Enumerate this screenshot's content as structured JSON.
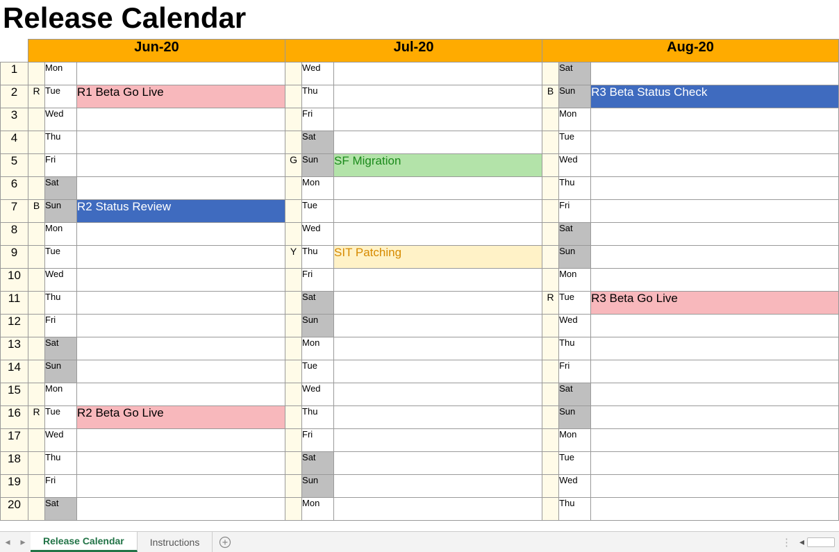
{
  "title": "Release Calendar",
  "months": [
    "Jun-20",
    "Jul-20",
    "Aug-20"
  ],
  "row_numbers": [
    1,
    2,
    3,
    4,
    5,
    6,
    7,
    8,
    9,
    10,
    11,
    12,
    13,
    14,
    15,
    16,
    17,
    18,
    19,
    20
  ],
  "rows": [
    {
      "m1": {
        "code": "",
        "day": "Mon",
        "weekend": false,
        "event": "",
        "color": ""
      },
      "m2": {
        "code": "",
        "day": "Wed",
        "weekend": false,
        "event": "",
        "color": ""
      },
      "m3": {
        "code": "",
        "day": "Sat",
        "weekend": true,
        "event": "",
        "color": ""
      }
    },
    {
      "m1": {
        "code": "R",
        "day": "Tue",
        "weekend": false,
        "event": "R1 Beta Go Live",
        "color": "red"
      },
      "m2": {
        "code": "",
        "day": "Thu",
        "weekend": false,
        "event": "",
        "color": ""
      },
      "m3": {
        "code": "B",
        "day": "Sun",
        "weekend": true,
        "event": "R3 Beta Status Check",
        "color": "blue"
      }
    },
    {
      "m1": {
        "code": "",
        "day": "Wed",
        "weekend": false,
        "event": "",
        "color": ""
      },
      "m2": {
        "code": "",
        "day": "Fri",
        "weekend": false,
        "event": "",
        "color": ""
      },
      "m3": {
        "code": "",
        "day": "Mon",
        "weekend": false,
        "event": "",
        "color": ""
      }
    },
    {
      "m1": {
        "code": "",
        "day": "Thu",
        "weekend": false,
        "event": "",
        "color": ""
      },
      "m2": {
        "code": "",
        "day": "Sat",
        "weekend": true,
        "event": "",
        "color": ""
      },
      "m3": {
        "code": "",
        "day": "Tue",
        "weekend": false,
        "event": "",
        "color": ""
      }
    },
    {
      "m1": {
        "code": "",
        "day": "Fri",
        "weekend": false,
        "event": "",
        "color": ""
      },
      "m2": {
        "code": "G",
        "day": "Sun",
        "weekend": true,
        "event": "SF Migration",
        "color": "green"
      },
      "m3": {
        "code": "",
        "day": "Wed",
        "weekend": false,
        "event": "",
        "color": ""
      }
    },
    {
      "m1": {
        "code": "",
        "day": "Sat",
        "weekend": true,
        "event": "",
        "color": ""
      },
      "m2": {
        "code": "",
        "day": "Mon",
        "weekend": false,
        "event": "",
        "color": ""
      },
      "m3": {
        "code": "",
        "day": "Thu",
        "weekend": false,
        "event": "",
        "color": ""
      }
    },
    {
      "m1": {
        "code": "B",
        "day": "Sun",
        "weekend": true,
        "event": "R2 Status Review",
        "color": "blue"
      },
      "m2": {
        "code": "",
        "day": "Tue",
        "weekend": false,
        "event": "",
        "color": ""
      },
      "m3": {
        "code": "",
        "day": "Fri",
        "weekend": false,
        "event": "",
        "color": ""
      }
    },
    {
      "m1": {
        "code": "",
        "day": "Mon",
        "weekend": false,
        "event": "",
        "color": ""
      },
      "m2": {
        "code": "",
        "day": "Wed",
        "weekend": false,
        "event": "",
        "color": ""
      },
      "m3": {
        "code": "",
        "day": "Sat",
        "weekend": true,
        "event": "",
        "color": ""
      }
    },
    {
      "m1": {
        "code": "",
        "day": "Tue",
        "weekend": false,
        "event": "",
        "color": ""
      },
      "m2": {
        "code": "Y",
        "day": "Thu",
        "weekend": false,
        "event": "SIT Patching",
        "color": "yellow"
      },
      "m3": {
        "code": "",
        "day": "Sun",
        "weekend": true,
        "event": "",
        "color": ""
      }
    },
    {
      "m1": {
        "code": "",
        "day": "Wed",
        "weekend": false,
        "event": "",
        "color": ""
      },
      "m2": {
        "code": "",
        "day": "Fri",
        "weekend": false,
        "event": "",
        "color": ""
      },
      "m3": {
        "code": "",
        "day": "Mon",
        "weekend": false,
        "event": "",
        "color": ""
      }
    },
    {
      "m1": {
        "code": "",
        "day": "Thu",
        "weekend": false,
        "event": "",
        "color": ""
      },
      "m2": {
        "code": "",
        "day": "Sat",
        "weekend": true,
        "event": "",
        "color": ""
      },
      "m3": {
        "code": "R",
        "day": "Tue",
        "weekend": false,
        "event": "R3 Beta Go Live",
        "color": "red"
      }
    },
    {
      "m1": {
        "code": "",
        "day": "Fri",
        "weekend": false,
        "event": "",
        "color": ""
      },
      "m2": {
        "code": "",
        "day": "Sun",
        "weekend": true,
        "event": "",
        "color": ""
      },
      "m3": {
        "code": "",
        "day": "Wed",
        "weekend": false,
        "event": "",
        "color": ""
      }
    },
    {
      "m1": {
        "code": "",
        "day": "Sat",
        "weekend": true,
        "event": "",
        "color": ""
      },
      "m2": {
        "code": "",
        "day": "Mon",
        "weekend": false,
        "event": "",
        "color": ""
      },
      "m3": {
        "code": "",
        "day": "Thu",
        "weekend": false,
        "event": "",
        "color": ""
      }
    },
    {
      "m1": {
        "code": "",
        "day": "Sun",
        "weekend": true,
        "event": "",
        "color": ""
      },
      "m2": {
        "code": "",
        "day": "Tue",
        "weekend": false,
        "event": "",
        "color": ""
      },
      "m3": {
        "code": "",
        "day": "Fri",
        "weekend": false,
        "event": "",
        "color": ""
      }
    },
    {
      "m1": {
        "code": "",
        "day": "Mon",
        "weekend": false,
        "event": "",
        "color": ""
      },
      "m2": {
        "code": "",
        "day": "Wed",
        "weekend": false,
        "event": "",
        "color": ""
      },
      "m3": {
        "code": "",
        "day": "Sat",
        "weekend": true,
        "event": "",
        "color": ""
      }
    },
    {
      "m1": {
        "code": "R",
        "day": "Tue",
        "weekend": false,
        "event": "R2 Beta Go Live",
        "color": "red"
      },
      "m2": {
        "code": "",
        "day": "Thu",
        "weekend": false,
        "event": "",
        "color": ""
      },
      "m3": {
        "code": "",
        "day": "Sun",
        "weekend": true,
        "event": "",
        "color": ""
      }
    },
    {
      "m1": {
        "code": "",
        "day": "Wed",
        "weekend": false,
        "event": "",
        "color": ""
      },
      "m2": {
        "code": "",
        "day": "Fri",
        "weekend": false,
        "event": "",
        "color": ""
      },
      "m3": {
        "code": "",
        "day": "Mon",
        "weekend": false,
        "event": "",
        "color": ""
      }
    },
    {
      "m1": {
        "code": "",
        "day": "Thu",
        "weekend": false,
        "event": "",
        "color": ""
      },
      "m2": {
        "code": "",
        "day": "Sat",
        "weekend": true,
        "event": "",
        "color": ""
      },
      "m3": {
        "code": "",
        "day": "Tue",
        "weekend": false,
        "event": "",
        "color": ""
      }
    },
    {
      "m1": {
        "code": "",
        "day": "Fri",
        "weekend": false,
        "event": "",
        "color": ""
      },
      "m2": {
        "code": "",
        "day": "Sun",
        "weekend": true,
        "event": "",
        "color": ""
      },
      "m3": {
        "code": "",
        "day": "Wed",
        "weekend": false,
        "event": "",
        "color": ""
      }
    },
    {
      "m1": {
        "code": "",
        "day": "Sat",
        "weekend": true,
        "event": "",
        "color": ""
      },
      "m2": {
        "code": "",
        "day": "Mon",
        "weekend": false,
        "event": "",
        "color": ""
      },
      "m3": {
        "code": "",
        "day": "Thu",
        "weekend": false,
        "event": "",
        "color": ""
      }
    }
  ],
  "tabs": {
    "active": "Release Calendar",
    "others": [
      "Instructions"
    ]
  },
  "colors": {
    "header_orange": "#ffab00",
    "row_number_bg": "#fffbe8",
    "weekend_grey": "#bfbfbf",
    "event_red": "#f8b8bc",
    "event_blue": "#3f6bbf",
    "event_green": "#b3e3a9",
    "event_yellow": "#fff2c7"
  }
}
